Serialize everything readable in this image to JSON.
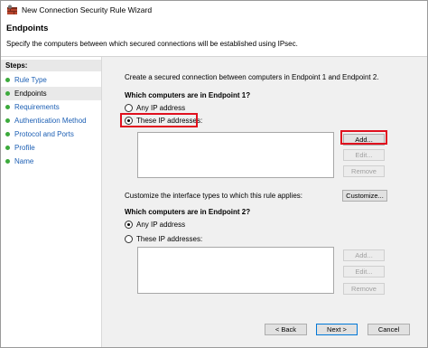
{
  "window": {
    "title": "New Connection Security Rule Wizard"
  },
  "header": {
    "title": "Endpoints",
    "description": "Specify the computers between which secured connections will be established using IPsec."
  },
  "steps": {
    "label": "Steps:",
    "items": [
      {
        "label": "Rule Type",
        "current": false
      },
      {
        "label": "Endpoints",
        "current": true
      },
      {
        "label": "Requirements",
        "current": false
      },
      {
        "label": "Authentication Method",
        "current": false
      },
      {
        "label": "Protocol and Ports",
        "current": false
      },
      {
        "label": "Profile",
        "current": false
      },
      {
        "label": "Name",
        "current": false
      }
    ]
  },
  "content": {
    "intro": "Create a secured connection between computers in Endpoint 1 and Endpoint 2.",
    "endpoint1": {
      "heading": "Which computers are in Endpoint 1?",
      "option_any": "Any IP address",
      "option_these": "These IP addresses:",
      "selected": "these",
      "add": "Add...",
      "edit": "Edit...",
      "remove": "Remove"
    },
    "customize_text": "Customize the interface types to which this rule applies:",
    "customize_button": "Customize...",
    "endpoint2": {
      "heading": "Which computers are in Endpoint 2?",
      "option_any": "Any IP address",
      "option_these": "These IP addresses:",
      "selected": "any",
      "add": "Add...",
      "edit": "Edit...",
      "remove": "Remove"
    }
  },
  "footer": {
    "back": "< Back",
    "next": "Next >",
    "cancel": "Cancel"
  },
  "colors": {
    "highlight": "#e0101e",
    "step_link": "#1c5fb4",
    "step_bullet": "#3caa3c"
  }
}
